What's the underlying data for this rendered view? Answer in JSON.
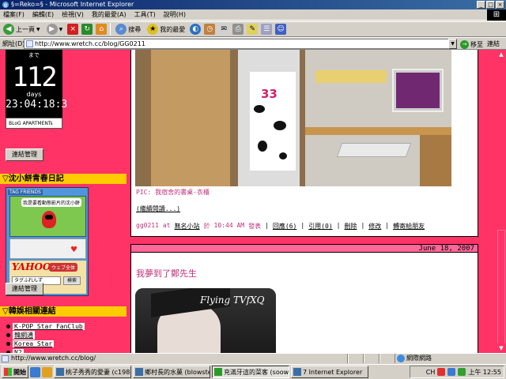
{
  "window": {
    "title": "§=Reko=§ - Microsoft Internet Explorer"
  },
  "menu": [
    "檔案(F)",
    "編輯(E)",
    "檢視(V)",
    "我的最愛(A)",
    "工具(T)",
    "說明(H)"
  ],
  "toolbar": {
    "back": "上一頁",
    "search": "搜尋",
    "favorites": "我的最愛"
  },
  "address": {
    "label": "網址(D)",
    "url": "http://www.wretch.cc/blog/GG0211",
    "go": "移至",
    "links": "連結"
  },
  "sidebar": {
    "clock_top": "まで",
    "days_num": "112",
    "days_label": "days",
    "time": "23:04:18:3",
    "apt": "BLoG APARTMENTs",
    "manage_btn": "連結管理",
    "header1": "▽沈小餅青春日記",
    "widget_title": "TAG FRIENDS",
    "speech": "我是要看動態影片的沈小餅",
    "yahoo_logo": "YAHOO!",
    "yahoo_jp": "ウェブ全体",
    "yahoo_input": "タグふれんず",
    "yahoo_search": "検索",
    "manage_btn2": "連結管理",
    "header2": "▽韓娛相關連結",
    "links": [
      "K-POP Star FanClub",
      "韓網通",
      "Korea Star",
      "N2"
    ]
  },
  "post1": {
    "caption": "PIC: 我宿舍的書桌-衣櫃",
    "readmore": "(繼續閱讀...)",
    "author": "gg0211",
    "at": "at",
    "site": "無名小站",
    "in": "於",
    "time": "10:44 AM",
    "posted": "發表",
    "reply": "回應(6)",
    "trackback": "引用(0)",
    "delete": "刪除",
    "edit": "修改",
    "share": "轉寄給朋友"
  },
  "post2": {
    "date": "June 18, 2007",
    "title": "我夢到了鄭先生",
    "watermark": "Flying TVfXQ"
  },
  "photo1": {
    "jersey_number": "33"
  },
  "status": {
    "text": "http://www.wretch.cc/blog/",
    "zone": "網際網路"
  },
  "taskbar": {
    "start": "開始",
    "tasks": [
      "桃子秀秀的愛妻 (c1986...",
      "鄉村長的水菓 (blowste...",
      "充滿牙這的菜客 (soowe...",
      "7 Internet Explorer"
    ],
    "clock": "上午 12:55",
    "lang": "CH"
  }
}
